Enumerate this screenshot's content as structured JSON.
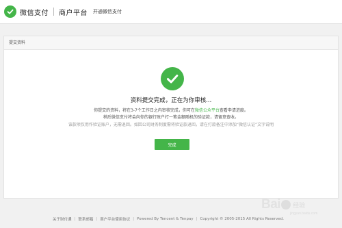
{
  "header": {
    "brand": "微信支付",
    "platform": "商户平台",
    "subtitle": "开通微信支付"
  },
  "panel": {
    "title": "提交资料",
    "success_title": "资料提交完成，正在为你审核...",
    "msg1_pre": "你提交的资料，将在3-7个工作日之内审核完成，你可在",
    "msg1_link": "微信公众平台",
    "msg1_post": "查看申请进度。",
    "msg2": "稍后微信支付将会向你的银行账户打一笔金额随机的验证款，请留意查收。",
    "msg3": "该款项仅用作验证账户，无需退回。如因公司财务制度需将验证款退回，请在打款备注中添加“微信认证”文字说明",
    "done_button": "完成"
  },
  "footer": {
    "links": [
      "关于财付通",
      "联系邮箱",
      "商户平台使用协议"
    ],
    "powered": "Powered By Tencent & Tenpay",
    "copyright": "Copyright © 2005-2015 All Rights Reserved."
  },
  "watermark": {
    "text": "Bai",
    "text2": "经验",
    "url": "jingyan.baidu.com"
  },
  "colors": {
    "accent": "#44b549",
    "background": "#f1f1f1"
  },
  "icons": {
    "logo": "wechat-pay-logo-icon",
    "success": "checkmark-icon"
  }
}
